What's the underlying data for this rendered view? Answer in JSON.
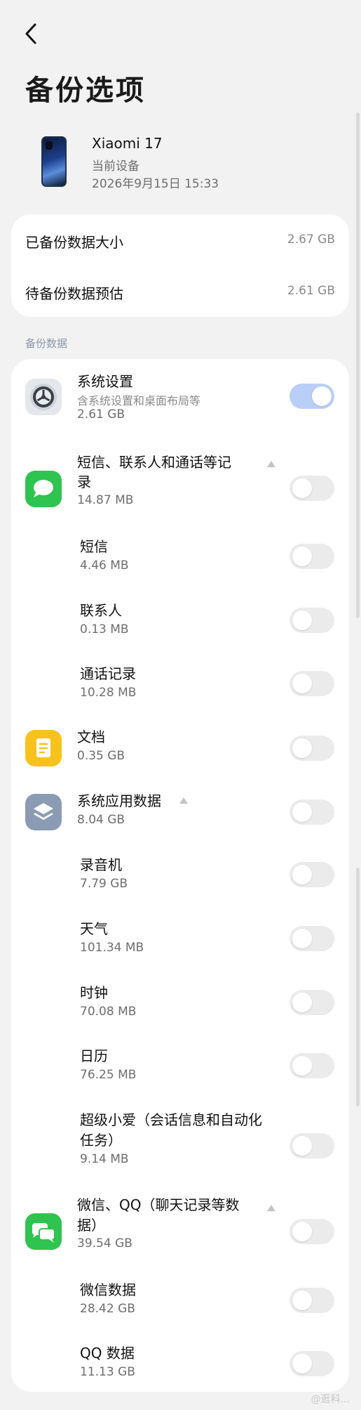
{
  "header": {
    "back_icon": "chevron-left-icon",
    "title": "备份选项"
  },
  "device": {
    "name": "Xiaomi 17",
    "subtitle": "当前设备",
    "time": "2026年9月15日 15:33"
  },
  "summary": {
    "backed_up_label": "已备份数据大小",
    "backed_up_value": "2.67 GB",
    "pending_label": "待备份数据预估",
    "pending_value": "2.61 GB"
  },
  "section_label": "备份数据",
  "items": [
    {
      "title": "系统设置",
      "desc": "含系统设置和桌面布局等",
      "size": "2.61 GB",
      "icon": "settings-icon",
      "toggle_on": true
    },
    {
      "title": "短信、联系人和通话等记",
      "title2": "录",
      "size": "14.87 MB",
      "icon": "message-icon",
      "toggle_on": false
    },
    {
      "title": "短信",
      "size": "4.46 MB",
      "toggle_on": false
    },
    {
      "title": "联系人",
      "size": "0.13 MB",
      "toggle_on": false
    },
    {
      "title": "通话记录",
      "size": "10.28 MB",
      "toggle_on": false
    },
    {
      "title": "文档",
      "size": "0.35 GB",
      "icon": "document-icon",
      "toggle_on": false
    },
    {
      "title": "系统应用数据",
      "size": "8.04 GB",
      "icon": "layers-icon",
      "toggle_on": false
    },
    {
      "title": "录音机",
      "size": "7.79 GB",
      "toggle_on": false
    },
    {
      "title": "天气",
      "size": "101.34 MB",
      "toggle_on": false
    },
    {
      "title": "时钟",
      "size": "70.08 MB",
      "toggle_on": false
    },
    {
      "title": "日历",
      "size": "76.25 MB",
      "toggle_on": false
    },
    {
      "title": "超级小爱（会话信息和自动化",
      "title2": "任务）",
      "size": "9.14 MB",
      "toggle_on": false
    },
    {
      "title": "微信、QQ（聊天记录等数",
      "title2": "据）",
      "size": "39.54 GB",
      "icon": "chat-bubbles-icon",
      "toggle_on": false
    },
    {
      "title": "微信数据",
      "size": "28.42 GB",
      "toggle_on": false
    },
    {
      "title": "QQ 数据",
      "size": "11.13 GB",
      "toggle_on": false
    }
  ],
  "colors": {
    "background": "#f2f2f2",
    "toggle_on": "#b9cff7",
    "toggle_off": "#ebebeb",
    "messages_icon": "#2fc34f",
    "documents_icon": "#f7c21c",
    "system_apps_icon": "#8b9bb3",
    "chat_icon": "#2fc34f"
  },
  "watermark": "@逛科..."
}
